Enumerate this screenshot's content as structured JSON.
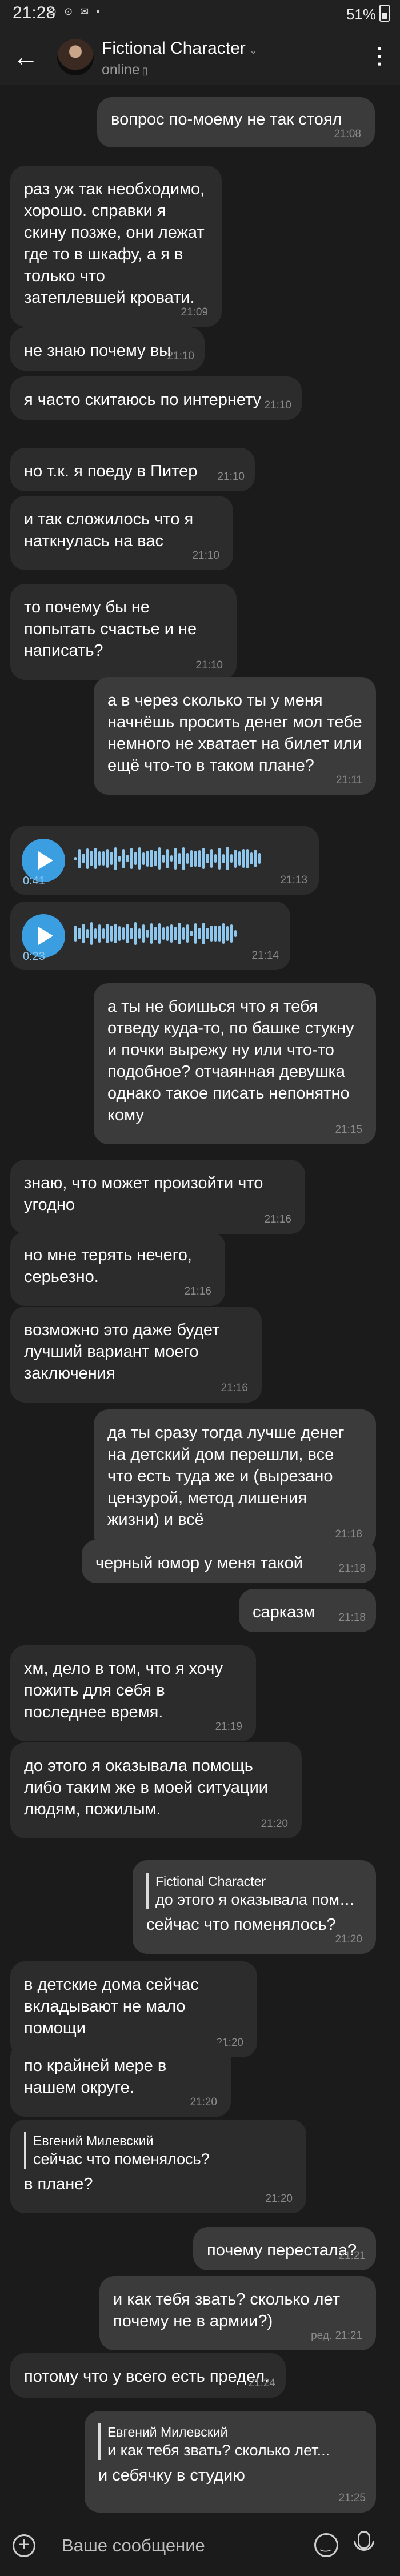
{
  "status_bar": {
    "time": "21:28",
    "icons": "⊙ ⊙ ✉ •",
    "battery": "51%"
  },
  "header": {
    "back": "←",
    "name": "Fictional Character",
    "chevron": "⌄",
    "status": "online",
    "status_icon": "▯",
    "menu": "⋮"
  },
  "messages": [
    {
      "dir": "out",
      "text": "вопрос по-моему не так стоял",
      "time": "21:08"
    },
    {
      "dir": "in",
      "text": "раз уж так необходимо, хорошо. справки я скину позже, они лежат где то в шкафу, а я в только что затеплевшей кровати.",
      "time": "21:09"
    },
    {
      "dir": "in",
      "text": "не знаю почему вы",
      "time": "21:10"
    },
    {
      "dir": "in",
      "text": "я часто скитаюсь по интернету",
      "time": "21:10"
    },
    {
      "dir": "in",
      "text": "но т.к. я поеду в Питер",
      "time": "21:10"
    },
    {
      "dir": "in",
      "text": "и так сложилось что я наткнулась на вас",
      "time": "21:10"
    },
    {
      "dir": "in",
      "text": "то почему бы не попытать счастье и не написать?",
      "time": "21:10"
    },
    {
      "dir": "out",
      "text": "а в через сколько ты у меня начнёшь просить денег мол тебе немного не хватает на билет или ещё что-то в таком плане?",
      "time": "21:11"
    },
    {
      "dir": "out",
      "text": "а ты не боишься что я тебя отведу куда-то, по башке стукну и почки вырежу ну или что-то подобное? отчаянная девушка однако такое писать непонятно кому",
      "time": "21:15"
    },
    {
      "dir": "in",
      "text": "знаю, что может произойти что угодно",
      "time": "21:16"
    },
    {
      "dir": "in",
      "text": "но мне терять нечего, серьезно.",
      "time": "21:16"
    },
    {
      "dir": "in",
      "text": "возможно это даже будет лучший вариант моего заключения",
      "time": "21:16"
    },
    {
      "dir": "out",
      "text": "да ты сразу тогда лучше денег на детский дом перешли, все что есть туда же и (вырезано цензурой, метод лишения жизни) и всё",
      "time": "21:18"
    },
    {
      "dir": "out",
      "text": "черный юмор у меня такой",
      "time": "21:18"
    },
    {
      "dir": "out",
      "text": "сарказм",
      "time": "21:18"
    },
    {
      "dir": "in",
      "text": "хм, дело в том, что я хочу пожить для себя в последнее время.",
      "time": "21:19"
    },
    {
      "dir": "in",
      "text": "до этого я оказывала помощь либо таким же в моей ситуации людям, пожилым.",
      "time": "21:20"
    },
    {
      "dir": "out",
      "reply_name": "Fictional Character",
      "reply_text": "до этого я оказывала помощь...",
      "text": "сейчас что поменялось?",
      "time": "21:20"
    },
    {
      "dir": "in",
      "text": "в детские дома сейчас вкладывают не мало помощи",
      "time": "21:20"
    },
    {
      "dir": "in",
      "text": "по крайней мере в нашем округе.",
      "time": "21:20"
    },
    {
      "dir": "in",
      "reply_name": "Евгений Милевский",
      "reply_text": "сейчас что поменялось?",
      "text": "в плане?",
      "time": "21:20"
    },
    {
      "dir": "out",
      "text": "почему перестала?",
      "time": "21:21"
    },
    {
      "dir": "out",
      "text": "и как тебя звать? сколько лет почему не в армии?)",
      "time": "ред. 21:21"
    },
    {
      "dir": "in",
      "text": "потому что у всего есть предел.",
      "time": "21:24"
    },
    {
      "dir": "in",
      "reply_name": "Евгений Милевский",
      "reply_text": "и как тебя звать? сколько лет...",
      "text": "и себячку в студию",
      "time": "21:25"
    }
  ],
  "voice_messages": [
    {
      "duration": "0:41",
      "time": "21:13",
      "icon": "play-icon"
    },
    {
      "duration": "0:23",
      "time": "21:14",
      "icon": "play-icon"
    }
  ],
  "composer": {
    "plus": "+",
    "placeholder": "Ваше сообщение"
  },
  "colors": {
    "background": "#1b1b1b",
    "incoming": "#2c2c2c",
    "outgoing": "#3b3b3b",
    "accent": "#3a9ee0",
    "timestamp": "#8a8a8a"
  }
}
